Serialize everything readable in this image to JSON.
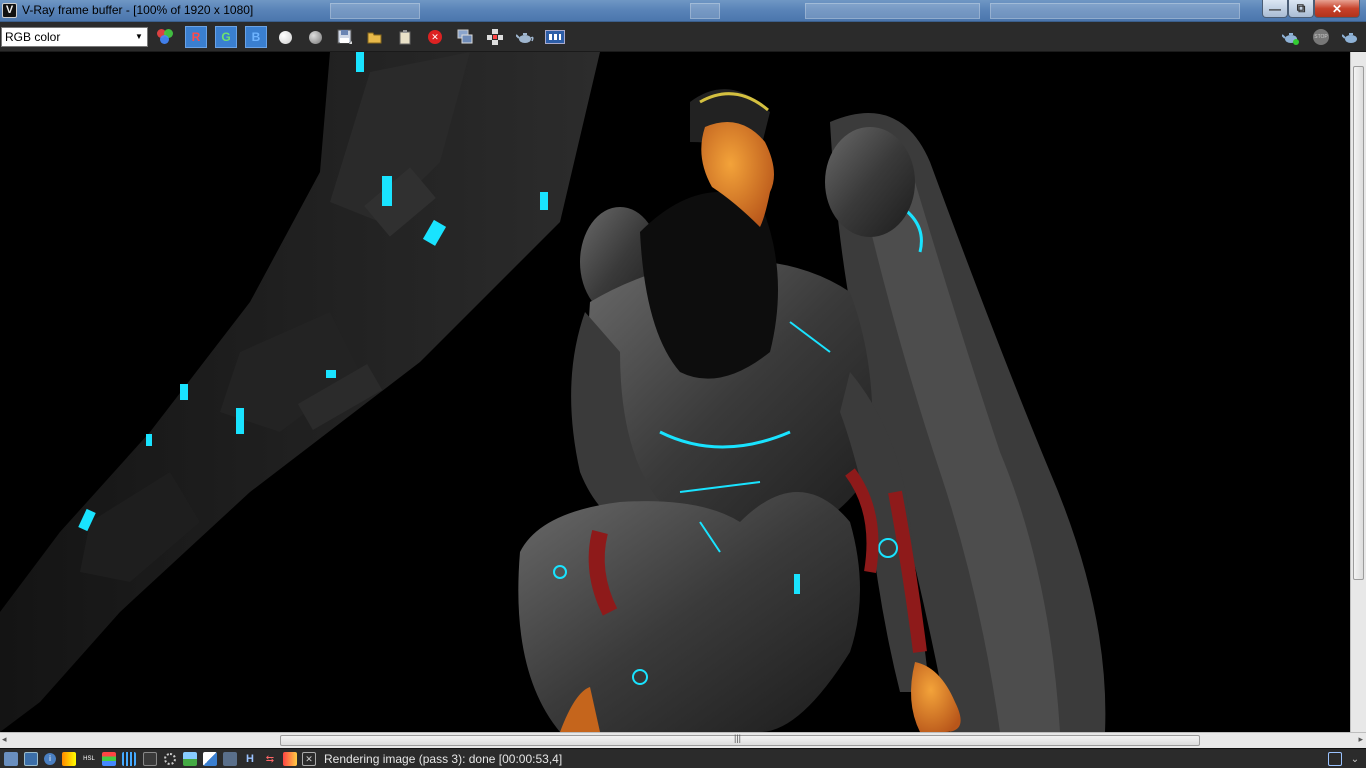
{
  "window": {
    "title": "V-Ray frame buffer - [100% of 1920 x 1080]",
    "background_titles": [
      "",
      "",
      "",
      ""
    ],
    "min_glyph": "—",
    "max_glyph": "⧉",
    "close_glyph": "✕"
  },
  "toolbar": {
    "channel_select_value": "RGB color",
    "channel_select_arrow": "▼",
    "r_label": "R",
    "g_label": "G",
    "b_label": "B"
  },
  "statusbar": {
    "text": "Rendering image (pass 3): done [00:00:53,4]",
    "h_label": "H"
  },
  "scrollbars": {
    "grip": "|||",
    "left_arrow": "◂",
    "right_arrow": "▸"
  },
  "colors": {
    "cyan_glow": "#19e3ff",
    "armor": "#4a4a4a",
    "accent_red": "#8e1a1a",
    "beak_orange": "#e08a24"
  }
}
